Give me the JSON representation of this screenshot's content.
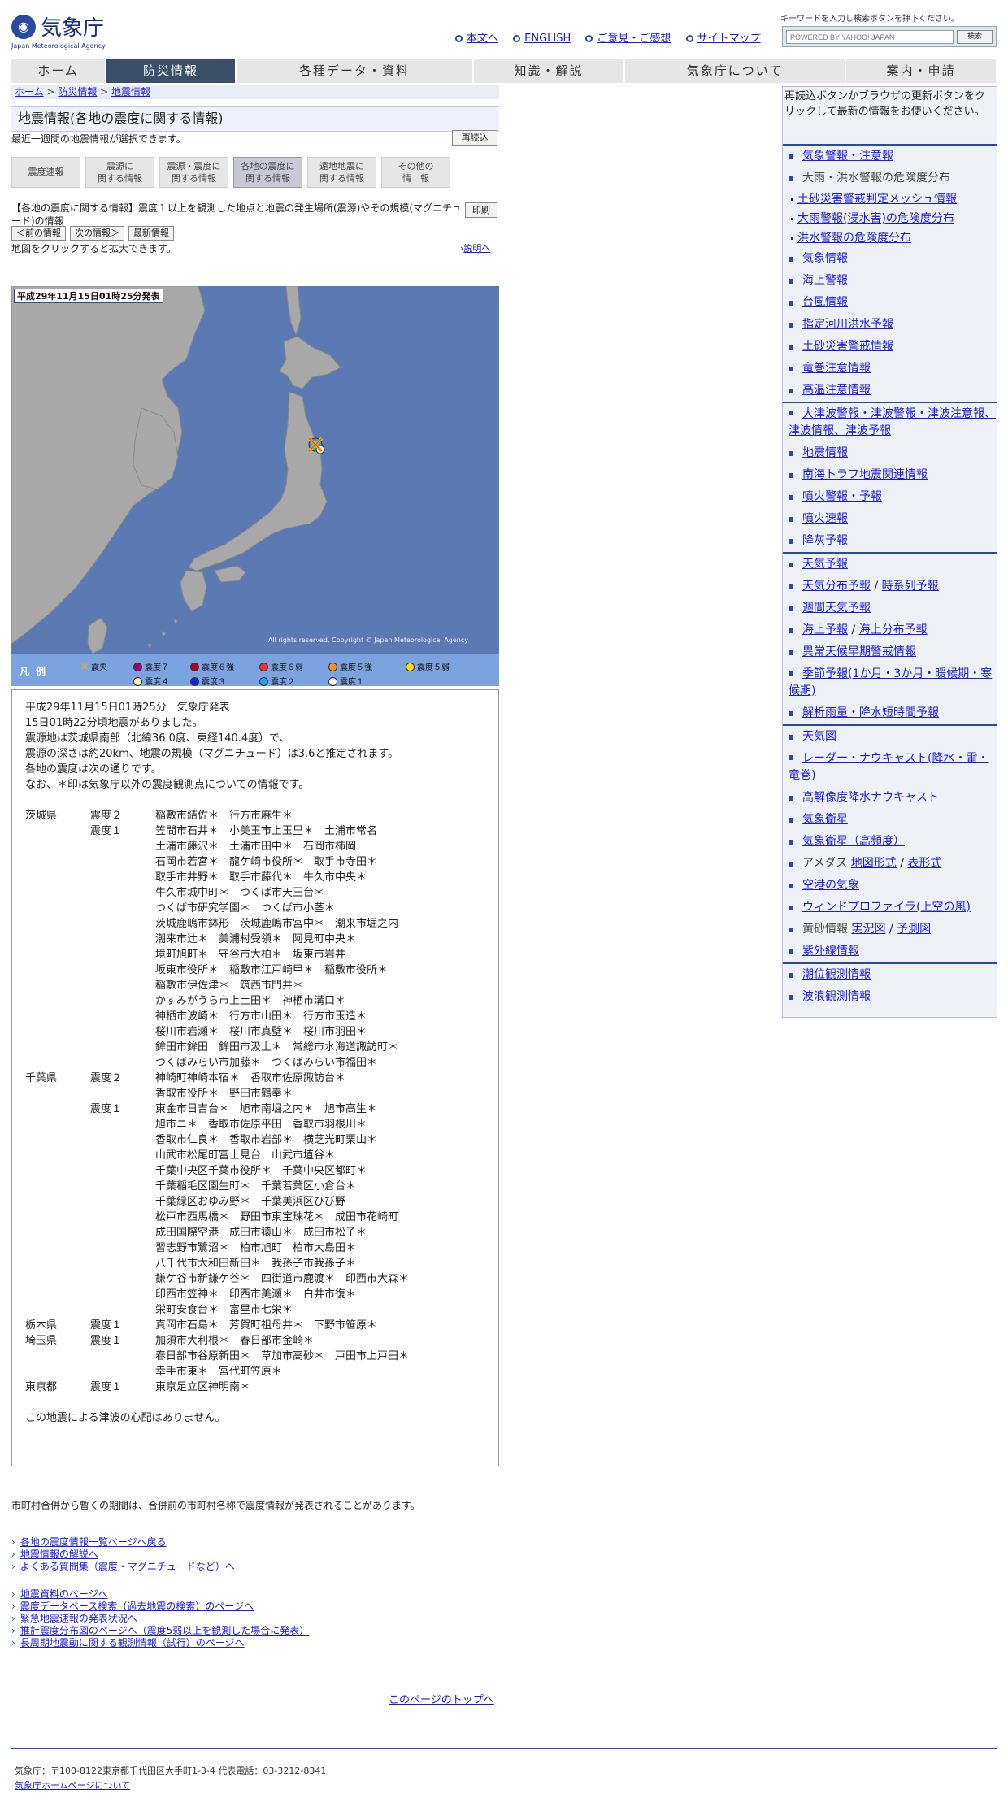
{
  "header": {
    "logo_ja": "気象庁",
    "logo_en": "Japan Meteorological Agency",
    "links": [
      "本文へ",
      "ENGLISH",
      "ご意見・ご感想",
      "サイトマップ"
    ],
    "search_caption": "キーワードを入力し検索ボタンを押下ください。",
    "search_placeholder": "POWERED BY YAHOO! JAPAN",
    "search_button": "検索"
  },
  "nav": [
    "ホーム",
    "防災情報",
    "各種データ・資料",
    "知識・解説",
    "気象庁について",
    "案内・申請"
  ],
  "breadcrumb": {
    "home": "ホーム",
    "sep": " > ",
    "cat": "防災情報",
    "page": "地震情報"
  },
  "page": {
    "title": "地震情報(各地の震度に関する情報)",
    "desc": "最近一週間の地震情報が選択できます。",
    "reload": "再読込"
  },
  "tabs": [
    [
      "震度速報"
    ],
    [
      "震源に",
      "関する情報"
    ],
    [
      "震源・震度に",
      "関する情報"
    ],
    [
      "各地の震度に",
      "関する情報"
    ],
    [
      "遠地地震に",
      "関する情報"
    ],
    [
      "その他の",
      "情　報"
    ]
  ],
  "info": {
    "title": "【各地の震度に関する情報】震度１以上を観測した地点と地震の発生場所(震源)やその規模(マグニチュード)の情報",
    "print": "印刷",
    "prev": "＜前の情報",
    "next": "次の情報＞",
    "latest": "最新情報",
    "zoom_note": "地図をクリックすると拡大できます。",
    "explain": "説明へ"
  },
  "map": {
    "date": "平成29年11月15日01時25分発表",
    "copyright": "All rights reserved, Copyright © Japan Meteorological Agency",
    "colors": {
      "sea": "#5b7ab3",
      "land": "#a8a8a8"
    }
  },
  "legend": {
    "label": "凡例",
    "items": [
      {
        "name": "震央",
        "color": "#f5a623"
      },
      {
        "name": "震度７",
        "color": "#a0007a"
      },
      {
        "name": "震度６強",
        "color": "#b0002a"
      },
      {
        "name": "震度６弱",
        "color": "#ff2a2a"
      },
      {
        "name": "震度５強",
        "color": "#ff8c1a"
      },
      {
        "name": "震度５弱",
        "color": "#ffe000"
      },
      {
        "name": "震度４",
        "color": "#fff2b0"
      },
      {
        "name": "震度３",
        "color": "#0a2ad0"
      },
      {
        "name": "震度２",
        "color": "#20a0ff"
      },
      {
        "name": "震度１",
        "color": "#ffffff"
      }
    ]
  },
  "report": {
    "intro": [
      "平成29年11月15日01時25分　気象庁発表",
      "15日01時22分頃地震がありました。",
      "震源地は茨城県南部（北緯36.0度、東経140.4度）で、",
      "震源の深さは約20km、地震の規模（マグニチュード）は3.6と推定されます。",
      "各地の震度は次の通りです。",
      "なお、＊印は気象庁以外の震度観測点についての情報です。"
    ],
    "rows": [
      [
        "茨城県",
        "震度２",
        "稲敷市結佐＊　行方市麻生＊"
      ],
      [
        "",
        "震度１",
        "笠間市石井＊　小美玉市上玉里＊　土浦市常名"
      ],
      [
        "",
        "",
        "土浦市藤沢＊　土浦市田中＊　石岡市柿岡"
      ],
      [
        "",
        "",
        "石岡市若宮＊　龍ケ崎市役所＊　取手市寺田＊"
      ],
      [
        "",
        "",
        "取手市井野＊　取手市藤代＊　牛久市中央＊"
      ],
      [
        "",
        "",
        "牛久市城中町＊　つくば市天王台＊"
      ],
      [
        "",
        "",
        "つくば市研究学園＊　つくば市小茎＊"
      ],
      [
        "",
        "",
        "茨城鹿嶋市鉢形　茨城鹿嶋市宮中＊　潮来市堀之内"
      ],
      [
        "",
        "",
        "潮来市辻＊　美浦村受領＊　阿見町中央＊"
      ],
      [
        "",
        "",
        "境町旭町＊　守谷市大柏＊　坂東市岩井"
      ],
      [
        "",
        "",
        "坂東市役所＊　稲敷市江戸崎甲＊　稲敷市役所＊"
      ],
      [
        "",
        "",
        "稲敷市伊佐津＊　筑西市門井＊"
      ],
      [
        "",
        "",
        "かすみがうら市上土田＊　神栖市溝口＊"
      ],
      [
        "",
        "",
        "神栖市波崎＊　行方市山田＊　行方市玉造＊"
      ],
      [
        "",
        "",
        "桜川市岩瀬＊　桜川市真壁＊　桜川市羽田＊"
      ],
      [
        "",
        "",
        "鉾田市鉾田　鉾田市汲上＊　常総市水海道諏訪町＊"
      ],
      [
        "",
        "",
        "つくばみらい市加藤＊　つくばみらい市福田＊"
      ],
      [
        "千葉県",
        "震度２",
        "神崎町神崎本宿＊　香取市佐原諏訪台＊"
      ],
      [
        "",
        "",
        "香取市役所＊　野田市鶴奉＊"
      ],
      [
        "",
        "震度１",
        "東金市日吉台＊　旭市南堀之内＊　旭市高生＊"
      ],
      [
        "",
        "",
        "旭市ニ＊　香取市佐原平田　香取市羽根川＊"
      ],
      [
        "",
        "",
        "香取市仁良＊　香取市岩部＊　横芝光町栗山＊"
      ],
      [
        "",
        "",
        "山武市松尾町富士見台　山武市埴谷＊"
      ],
      [
        "",
        "",
        "千葉中央区千葉市役所＊　千葉中央区都町＊"
      ],
      [
        "",
        "",
        "千葉稲毛区園生町＊　千葉若葉区小倉台＊"
      ],
      [
        "",
        "",
        "千葉緑区おゆみ野＊　千葉美浜区ひび野"
      ],
      [
        "",
        "",
        "松戸市西馬橋＊　野田市東宝珠花＊　成田市花崎町"
      ],
      [
        "",
        "",
        "成田国際空港　成田市猿山＊　成田市松子＊"
      ],
      [
        "",
        "",
        "習志野市鷺沼＊　柏市旭町　柏市大島田＊"
      ],
      [
        "",
        "",
        "八千代市大和田新田＊　我孫子市我孫子＊"
      ],
      [
        "",
        "",
        "鎌ケ谷市新鎌ケ谷＊　四街道市鹿渡＊　印西市大森＊"
      ],
      [
        "",
        "",
        "印西市笠神＊　印西市美瀬＊　白井市復＊"
      ],
      [
        "",
        "",
        "栄町安食台＊　富里市七栄＊"
      ],
      [
        "栃木県",
        "震度１",
        "真岡市石島＊　芳賀町祖母井＊　下野市笹原＊"
      ],
      [
        "埼玉県",
        "震度１",
        "加須市大利根＊　春日部市金崎＊"
      ],
      [
        "",
        "",
        "春日部市谷原新田＊　草加市高砂＊　戸田市上戸田＊"
      ],
      [
        "",
        "",
        "幸手市東＊　宮代町笠原＊"
      ],
      [
        "東京都",
        "震度１",
        "東京足立区神明南＊"
      ]
    ],
    "tsunami": "この地震による津波の心配はありません。"
  },
  "notes": {
    "gappei": "市町村合併から暫くの期間は、合併前の市町村名称で震度情報が発表されることがあります。",
    "links1": [
      "各地の震度情報一覧ページへ戻る",
      "地震情報の解説へ",
      "よくある質問集（震度・マグニチュードなど）へ"
    ],
    "links2": [
      "地震資料のページへ",
      "震度データベース検索（過去地震の検索）のページへ",
      "緊急地震速報の発表状況へ",
      "推計震度分布図のページへ（震度5弱以上を観測した場合に発表）",
      "長周期地震動に関する観測情報（試行）のページへ"
    ],
    "pagetop": "このページのトップへ"
  },
  "footer": {
    "address": "気象庁：〒100-8122東京都千代田区大手町1-3-4 代表電話：03-3212-8341",
    "about": "気象庁ホームページについて"
  },
  "sidebar": {
    "note": "再読込ボタンかブラウザの更新ボタンをクリックして最新の情報をお使いください。",
    "groups": [
      [
        {
          "t": "気象警報・注意報"
        },
        {
          "t": "大雨・洪水警報の危険度分布",
          "plain": true
        },
        {
          "t": "土砂災害警戒判定メッシュ情報",
          "sub": true
        },
        {
          "t": "大雨警報(浸水害)の危険度分布",
          "sub": true
        },
        {
          "t": "洪水警報の危険度分布",
          "sub": true
        },
        {
          "t": "気象情報"
        },
        {
          "t": "海上警報"
        },
        {
          "t": "台風情報"
        },
        {
          "t": "指定河川洪水予報"
        },
        {
          "t": "土砂災害警戒情報"
        },
        {
          "t": "竜巻注意情報"
        },
        {
          "t": "高温注意情報"
        }
      ],
      [
        {
          "t": "大津波警報・津波警報・津波注意報、津波情報、津波予報",
          "wrap": true
        },
        {
          "t": "地震情報"
        },
        {
          "t": "南海トラフ地震関連情報"
        },
        {
          "t": "噴火警報・予報"
        },
        {
          "t": "噴火速報"
        },
        {
          "t": "降灰予報"
        }
      ],
      [
        {
          "t": "天気予報"
        },
        {
          "t": "天気分布予報",
          "t2": "時系列予報"
        },
        {
          "t": "週間天気予報"
        },
        {
          "t": "海上予報",
          "t2": "海上分布予報"
        },
        {
          "t": "異常天候早期警戒情報"
        },
        {
          "t": "季節予報(1か月・3か月・暖候期・寒候期)",
          "wrap": true
        },
        {
          "t": "解析雨量・降水短時間予報"
        }
      ],
      [
        {
          "t": "天気図"
        },
        {
          "t": "レーダー・ナウキャスト(降水・雷・竜巻)",
          "wrap": true
        },
        {
          "t": "高解像度降水ナウキャスト"
        },
        {
          "t": "気象衛星"
        },
        {
          "t": "気象衛星（高頻度）"
        },
        {
          "t": "地図形式",
          "pre": "アメダス",
          "t2": "表形式"
        },
        {
          "t": "空港の気象"
        },
        {
          "t": "ウィンドプロファイラ(上空の風)"
        },
        {
          "t": "実況図",
          "pre": "黄砂情報",
          "t2": "予測図"
        },
        {
          "t": "紫外線情報"
        }
      ],
      [
        {
          "t": "潮位観測情報"
        },
        {
          "t": "波浪観測情報"
        }
      ]
    ]
  }
}
